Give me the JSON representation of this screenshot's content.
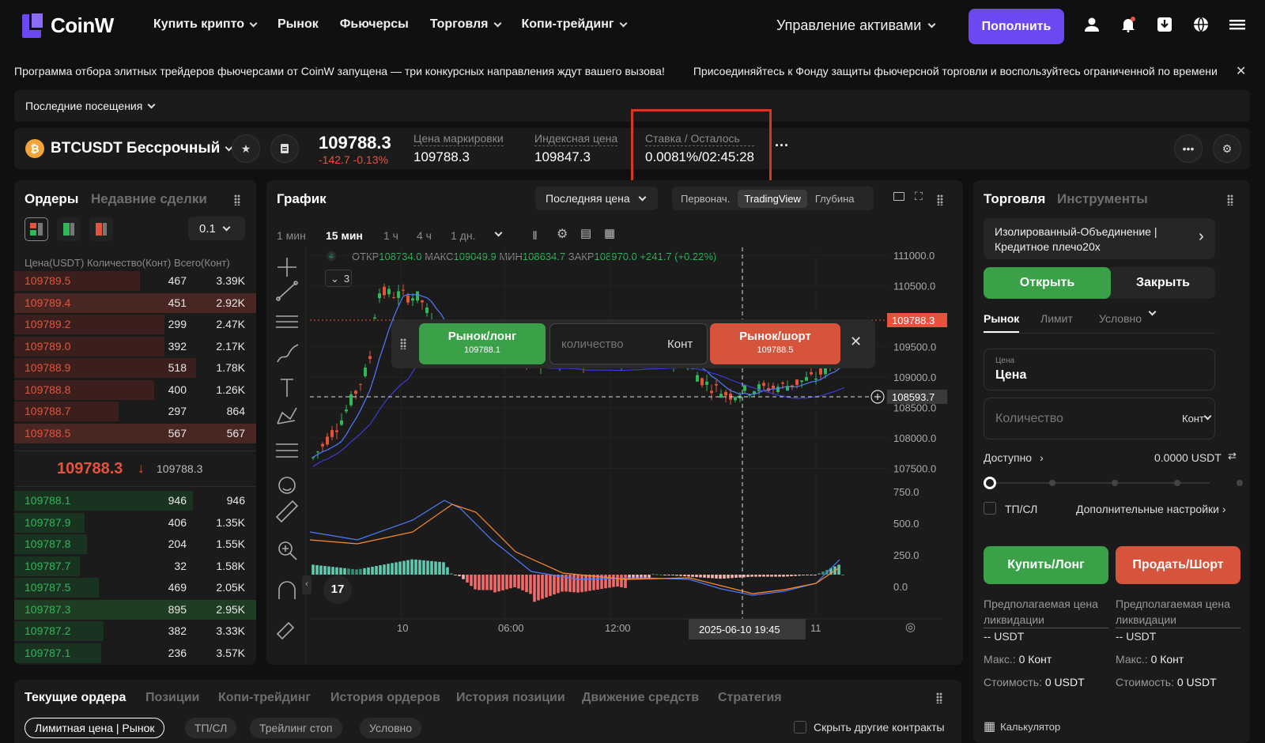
{
  "brand": {
    "name": "CoinW",
    "accent": "#6b48f2"
  },
  "nav": {
    "items": [
      "Купить крипто",
      "Рынок",
      "Фьючерсы",
      "Торговля",
      "Копи-трейдинг"
    ],
    "assets": "Управление активами",
    "deposit": "Пополнить"
  },
  "ticker": {
    "msg1": "Программа отбора элитных трейдеров фьючерсами от CoinW запущена — три конкурсных направления ждут вашего вызова!",
    "msg2": "Присоединяйтесь к Фонду защиты фьючерсной торговли и воспользуйтесь ограниченной по времени"
  },
  "recent": "Последние посещения",
  "symbol": {
    "name": "BTCUSDT Бессрочный",
    "price": "109788.3",
    "change": "-142.7 -0.13%",
    "mark_label": "Цена маркировки",
    "mark_value": "109788.3",
    "index_label": "Индексная цена",
    "index_value": "109847.3",
    "rate_label": "Ставка / Осталось",
    "rate_value": "0.0081%/02:45:28",
    "more": "···"
  },
  "orderbook": {
    "tab1": "Ордеры",
    "tab2": "Недавние сделки",
    "precision": "0.1",
    "h_price": "Цена(USDT)",
    "h_qty": "Количество(Конт)",
    "h_total": "Всего(Конт)",
    "asks": [
      [
        "109789.5",
        "467",
        "3.39K",
        0.52
      ],
      [
        "109789.4",
        "451",
        "2.92K",
        1.0
      ],
      [
        "109789.2",
        "299",
        "2.47K",
        0.62
      ],
      [
        "109789.0",
        "392",
        "2.17K",
        0.62
      ],
      [
        "109788.9",
        "518",
        "1.78K",
        0.75
      ],
      [
        "109788.8",
        "400",
        "1.26K",
        0.58
      ],
      [
        "109788.7",
        "297",
        "864",
        0.43
      ],
      [
        "109788.5",
        "567",
        "567",
        1.0
      ]
    ],
    "last": "109788.3",
    "arrow": "↓",
    "mark": "109788.3",
    "bids": [
      [
        "109788.1",
        "946",
        "946",
        0.74
      ],
      [
        "109787.9",
        "406",
        "1.35K",
        0.29
      ],
      [
        "109787.8",
        "204",
        "1.55K",
        0.3
      ],
      [
        "109787.7",
        "32",
        "1.58K",
        0.27
      ],
      [
        "109787.5",
        "469",
        "2.05K",
        0.35
      ],
      [
        "109787.3",
        "895",
        "2.95K",
        1.0
      ],
      [
        "109787.2",
        "382",
        "3.33K",
        0.37
      ],
      [
        "109787.1",
        "236",
        "3.57K",
        0.36
      ]
    ]
  },
  "chart": {
    "title": "График",
    "price_type": "Последняя цена",
    "views": [
      "Первонач.",
      "TradingView",
      "Глубина"
    ],
    "timeframes": [
      "1 мин",
      "15 мин",
      "1 ч",
      "4 ч",
      "1 дн."
    ],
    "ohlc": {
      "o_label": "ОТКР",
      "o": "108734.0",
      "h_label": "МАКС",
      "h": "109049.9",
      "l_label": "МИН",
      "l": "108634.7",
      "c_label": "ЗАКР",
      "c": "108970.0",
      "chg": "+241.7 (+0.22%)"
    },
    "indicators": "3",
    "y_ticks": [
      "111000.0",
      "110500.0",
      "110000.0",
      "109500.0",
      "109000.0",
      "108500.0",
      "108000.0",
      "107500.0"
    ],
    "macd_ticks": [
      "750.0",
      "500.0",
      "250.0",
      "0.0"
    ],
    "last_price_tag": "109788.3",
    "cross_price_tag": "108593.7",
    "x_ticks": [
      "10",
      "06:00",
      "12:00",
      "11"
    ],
    "cross_date": "2025-06-10",
    "cross_time": "19:45",
    "quick": {
      "long": "Рынок/лонг",
      "long_price": "109788.1",
      "qty_ph": "количество",
      "unit": "Конт",
      "short": "Рынок/шорт",
      "short_price": "109788.5"
    }
  },
  "trade": {
    "tab1": "Торговля",
    "tab2": "Инструменты",
    "margin": "Изолированный-Объединение | Кредитное плечо20x",
    "open": "Открыть",
    "close": "Закрыть",
    "types": [
      "Рынок",
      "Лимит",
      "Условно"
    ],
    "price_label": "Цена",
    "price_value": "Цена",
    "qty_ph": "Количество",
    "qty_unit": "Конт",
    "avail_label": "Доступно",
    "avail_value": "0.0000 USDT",
    "tpsl": "ТП/СЛ",
    "adv": "Дополнительные настройки",
    "buy": "Купить/Лонг",
    "sell": "Продать/Шорт",
    "liq_label": "Предполагаемая цена ликвидации",
    "liq_value": "-- USDT",
    "max_label": "Макс.:",
    "max_value": "0 Конт",
    "cost_label": "Стоимость:",
    "cost_value": "0 USDT",
    "calc": "Калькулятор",
    "leverage_pct": 0
  },
  "bottom": {
    "tabs": [
      "Текущие ордера",
      "Позиции",
      "Копи-трейдинг",
      "История ордеров",
      "История позиции",
      "Движение средств",
      "Стратегия"
    ],
    "pills": [
      "Лимитная цена | Рынок",
      "ТП/СЛ",
      "Трейлинг стоп",
      "Условно"
    ],
    "hide": "Скрыть другие контракты"
  },
  "colors": {
    "up": "#2fb75a",
    "down": "#e5533d",
    "panel": "#1b1b1b"
  }
}
